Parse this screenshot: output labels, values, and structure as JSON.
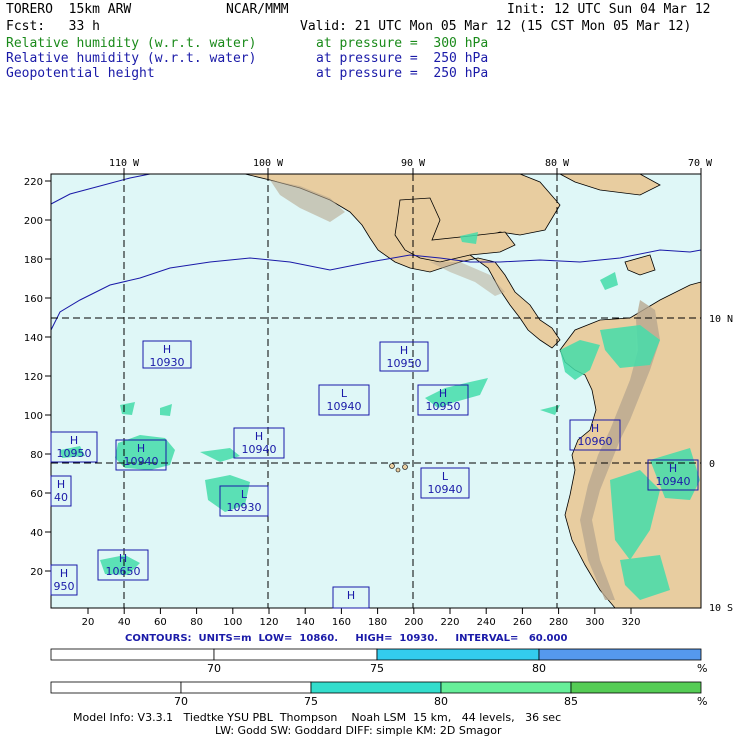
{
  "header": {
    "model": "TORERO  15km ARW",
    "org": "NCAR/MMM",
    "init": "Init: 12 UTC Sun 04 Mar 12",
    "fcst": "Fcst:   33 h",
    "valid": "Valid: 21 UTC Mon 05 Mar 12 (15 CST Mon 05 Mar 12)"
  },
  "fields": [
    {
      "name": "Relative humidity (w.r.t. water)",
      "level": "at pressure =  300 hPa",
      "color": "#1a8a1a"
    },
    {
      "name": "Relative humidity (w.r.t. water)",
      "level": "at pressure =  250 hPa",
      "color": "#1a1aa8"
    },
    {
      "name": "Geopotential height",
      "level": "at pressure =  250 hPa",
      "color": "#1a1aa8"
    }
  ],
  "map": {
    "top_lon_labels": [
      "110 W",
      "100 W",
      "90 W",
      "80 W",
      "70 W"
    ],
    "right_lat_labels": [
      "10 N",
      "0",
      "10 S"
    ],
    "y_ticks": [
      "220",
      "200",
      "180",
      "160",
      "140",
      "120",
      "100",
      "80",
      "60",
      "40",
      "20"
    ],
    "x_ticks": [
      "20",
      "40",
      "60",
      "80",
      "100",
      "120",
      "140",
      "160",
      "180",
      "200",
      "220",
      "240",
      "260",
      "280",
      "300",
      "320"
    ],
    "ocean_color": "#dff7f7",
    "land_color": "#e8cda0",
    "high_lows": [
      {
        "letter": "H",
        "value": "10930"
      },
      {
        "letter": "H",
        "value": "10950"
      },
      {
        "letter": "L",
        "value": "10940"
      },
      {
        "letter": "H",
        "value": "10950"
      },
      {
        "letter": "H",
        "value": "10950"
      },
      {
        "letter": "H",
        "value": "10940"
      },
      {
        "letter": "H",
        "value": "10940"
      },
      {
        "letter": "L",
        "value": "10930"
      },
      {
        "letter": "L",
        "value": "10940"
      },
      {
        "letter": "H",
        "value": "10960"
      },
      {
        "letter": "H",
        "value": "10940"
      },
      {
        "letter": "H",
        "value": "10650"
      },
      {
        "letter": "H",
        "value": "950"
      },
      {
        "letter": "H",
        "value": "40"
      },
      {
        "letter": "H",
        "value": ""
      }
    ]
  },
  "contours_line": "CONTOURS:  UNITS=m  LOW=  10860.     HIGH=  10930.     INTERVAL=   60.000",
  "colorbar1": {
    "labels": [
      "70",
      "75",
      "80",
      "%"
    ],
    "colors": [
      "#ffffff",
      "#ffffff",
      "#33ccee",
      "#5599ee"
    ]
  },
  "colorbar2": {
    "labels": [
      "70",
      "75",
      "80",
      "85",
      "%"
    ],
    "colors": [
      "#ffffff",
      "#ffffff",
      "#33ddcc",
      "#66ee99",
      "#55cc55"
    ]
  },
  "model_info": {
    "line1": "Model Info: V3.3.1   Tiedtke YSU PBL  Thompson    Noah LSM  15 km,   44 levels,   36 sec",
    "line2": "LW: Godd SW: Goddard DIFF: simple KM: 2D Smagor"
  }
}
